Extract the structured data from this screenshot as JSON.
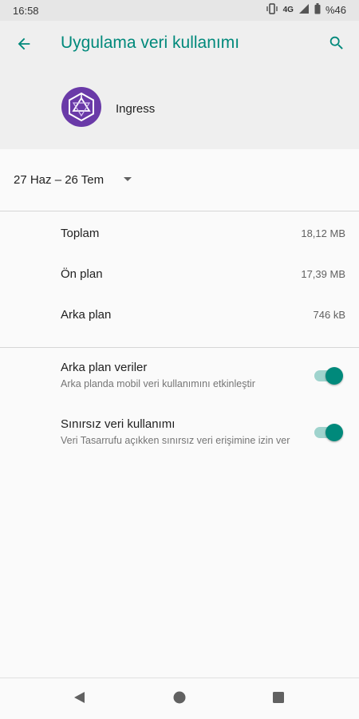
{
  "status_bar": {
    "time": "16:58",
    "network": "4G",
    "battery": "%46",
    "icons": [
      "vibrate-icon",
      "network-4g-icon",
      "signal-icon",
      "battery-icon"
    ]
  },
  "app_bar": {
    "title": "Uygulama veri kullanımı",
    "accent_color": "#00897b"
  },
  "app": {
    "name": "Ingress",
    "icon": "ingress-icon",
    "icon_color": "#6a3aa8"
  },
  "cycle": {
    "label": "27 Haz – 26 Tem"
  },
  "usage": [
    {
      "label": "Toplam",
      "value": "18,12 MB"
    },
    {
      "label": "Ön plan",
      "value": "17,39 MB"
    },
    {
      "label": "Arka plan",
      "value": "746 kB"
    }
  ],
  "switches": [
    {
      "title": "Arka plan veriler",
      "summary": "Arka planda mobil veri kullanımını etkinleştir",
      "checked": true
    },
    {
      "title": "Sınırsız veri kullanımı",
      "summary": "Veri Tasarrufu açıkken sınırsız veri erişimine izin ver",
      "checked": true
    }
  ],
  "nav_bar": {
    "icons": [
      "back-triangle-icon",
      "home-circle-icon",
      "recents-square-icon"
    ]
  }
}
